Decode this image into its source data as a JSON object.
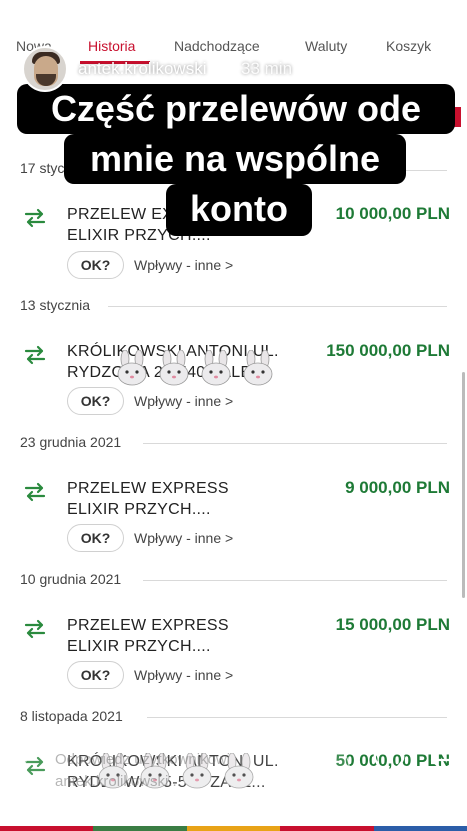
{
  "story": {
    "progress_segments": [
      1,
      1,
      1,
      1,
      1,
      0
    ],
    "username": "antek.krolikowski",
    "time_ago": "33 min",
    "caption_lines": [
      "Część przelewów ode",
      "mnie na wspólne",
      "konto"
    ],
    "reply_placeholder": "Odpowiedz użytkownikowi",
    "reply_placeholder_2": "antek.krolikowski..."
  },
  "bank": {
    "tabs": [
      "Nowa",
      "Historia",
      "Nadchodzące",
      "Waluty",
      "Koszyk"
    ],
    "active_tab": "Historia",
    "transactions": [
      {
        "date": "17 stycznia",
        "title_1": "PRZELEW EXPRESS",
        "title_2": "ELIXIR PRZYCH....",
        "amount": "10 000,00 PLN",
        "ok": "OK?",
        "category": "Wpływy - inne >"
      },
      {
        "date": "13 stycznia",
        "title_1": "KRÓLIKOWSKI ANTONI UL.",
        "title_2": "RYDZOWA 25-540 ZALE...",
        "amount": "150 000,00 PLN",
        "ok": "OK?",
        "category": "Wpływy - inne >"
      },
      {
        "date": "23 grudnia 2021",
        "title_1": "PRZELEW EXPRESS",
        "title_2": "ELIXIR PRZYCH....",
        "amount": "9 000,00 PLN",
        "ok": "OK?",
        "category": "Wpływy - inne >"
      },
      {
        "date": "10 grudnia 2021",
        "title_1": "PRZELEW EXPRESS",
        "title_2": "ELIXIR PRZYCH....",
        "amount": "15 000,00 PLN",
        "ok": "OK?",
        "category": "Wpływy - inne >"
      },
      {
        "date": "8 listopada 2021",
        "title_1": "KRÓLIKOWSKI ANTONI UL.",
        "title_2": "RYDZOWA 25-540 ZALE...",
        "amount": "50 000,00 PLN",
        "ok": "OK?",
        "category": "Wpływy - inne >"
      }
    ]
  },
  "colors": {
    "accent": "#c8102e",
    "amount_green": "#1e7a36",
    "caption_bg": "#000000"
  },
  "icons": [
    "play-icon",
    "mute-icon",
    "more-icon",
    "transfer-icon",
    "bunny-emoji",
    "heart-icon",
    "send-icon"
  ]
}
